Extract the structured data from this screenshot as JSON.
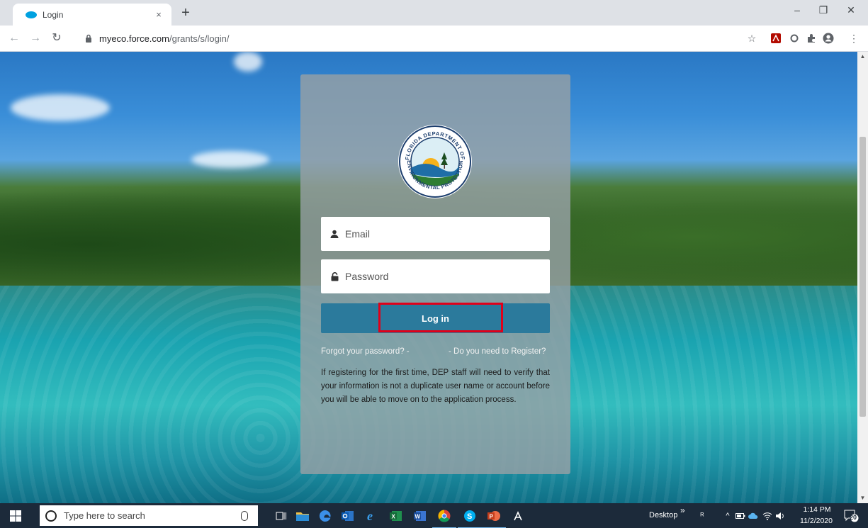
{
  "browser": {
    "tab_title": "Login",
    "tab_close": "×",
    "new_tab": "+",
    "window": {
      "minimize": "–",
      "restore": "❐",
      "close": "✕"
    },
    "url_host": "myeco.force.com",
    "url_path": "/grants/s/login/"
  },
  "login": {
    "logo_lines": [
      "FLORIDA DEPARTMENT OF",
      "ENVIRONMENTAL PROTECTION"
    ],
    "email_placeholder": "Email",
    "password_placeholder": "Password",
    "login_label": "Log in",
    "forgot_link": "Forgot your password? -",
    "register_link": "- Do you need to Register?",
    "info_text": "If registering for the first time, DEP staff will need to verify that your information is not a duplicate user name or account before you will be able to move on to the application process."
  },
  "taskbar": {
    "search_placeholder": "Type here to search",
    "desktop_label": "Desktop",
    "overflow": "»",
    "time": "1:14 PM",
    "date": "11/2/2020",
    "notifications": "20"
  },
  "colors": {
    "login_button": "#2b7a9c",
    "highlight_border": "#e0001a",
    "card_overlay": "rgba(150,160,165,0.82)",
    "taskbar": "#1c2a3a"
  }
}
